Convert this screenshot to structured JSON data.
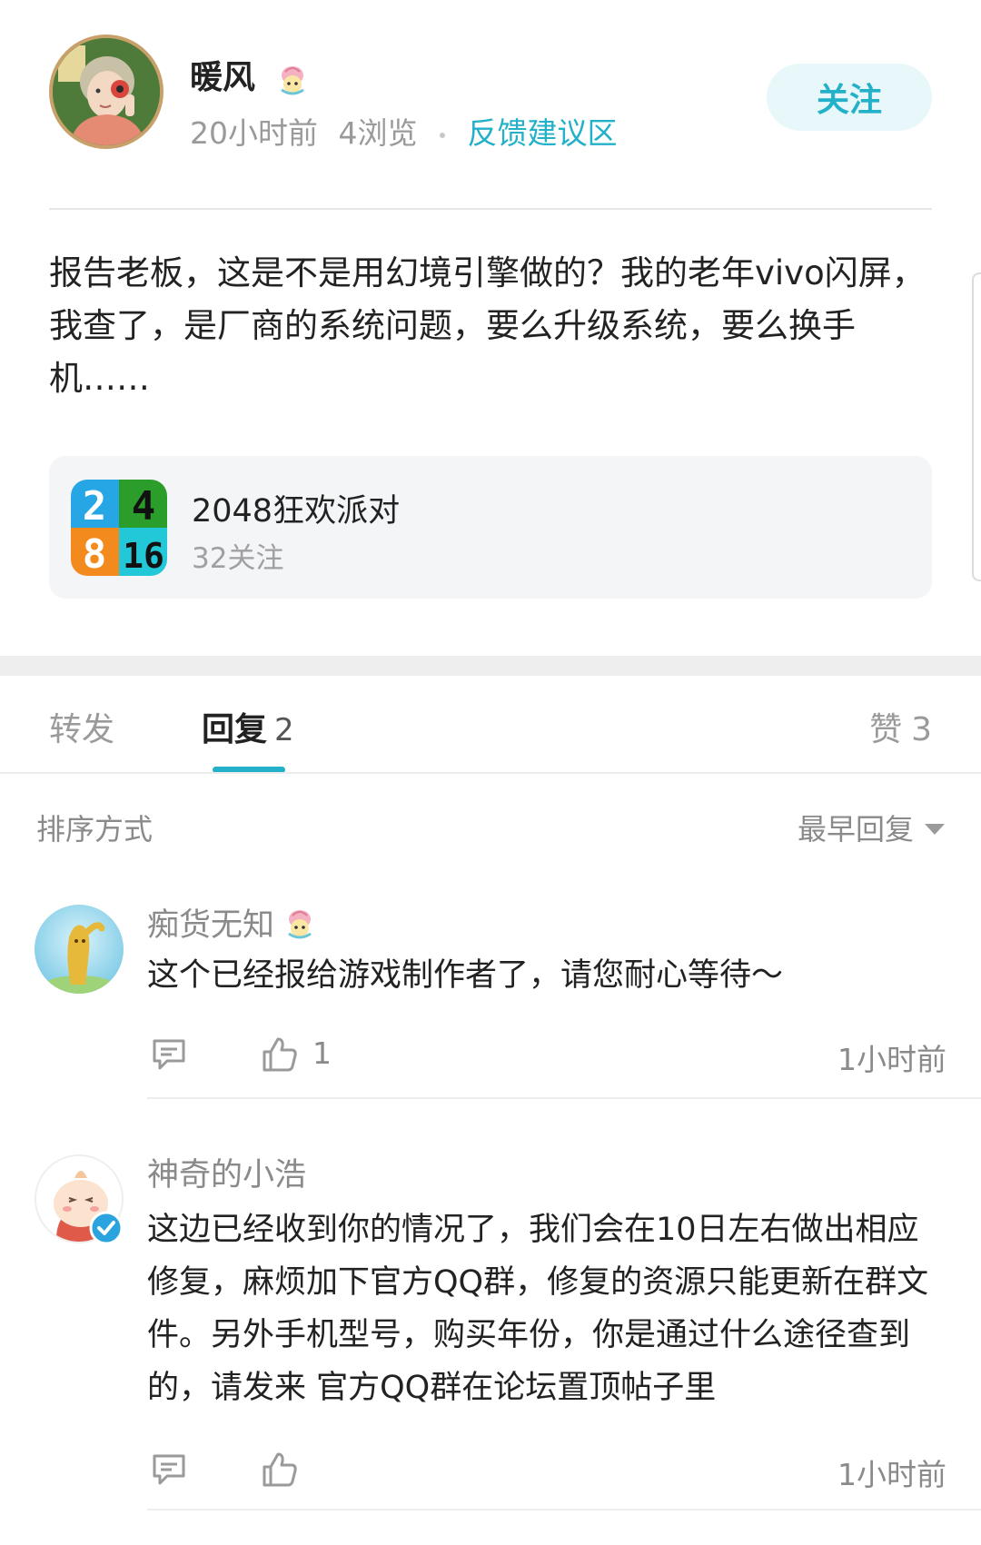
{
  "post": {
    "author_name": "暖风",
    "time": "20小时前",
    "views": "4浏览",
    "section": "反馈建议区",
    "follow_label": "关注",
    "body": "报告老板，这是不是用幻境引擎做的？我的老年vivo闪屏，我查了，是厂商的系统问题，要么升级系统，要么换手机……"
  },
  "game_card": {
    "title": "2048狂欢派对",
    "followers": "32关注",
    "icon_digits": [
      "2",
      "4",
      "8",
      "16"
    ]
  },
  "tabs": {
    "forward_label": "转发",
    "reply_label": "回复",
    "reply_count": "2",
    "like_label": "赞",
    "like_count": "3"
  },
  "sort": {
    "label": "排序方式",
    "selected": "最早回复"
  },
  "comments": [
    {
      "name": "痴货无知",
      "text": "这个已经报给游戏制作者了，请您耐心等待～",
      "like_count": "1",
      "time": "1小时前"
    },
    {
      "name": "神奇的小浩",
      "text": "这边已经收到你的情况了，我们会在10日左右做出相应修复，麻烦加下官方QQ群，修复的资源只能更新在群文件。另外手机型号，购买年份，你是通过什么途径查到的，请发来 官方QQ群在论坛置顶帖子里",
      "like_count": "",
      "time": "1小时前"
    }
  ],
  "colors": {
    "accent": "#23b0c9",
    "follow_bg": "#e8f7f9",
    "secondary_text": "#8a8a8a",
    "card_bg": "#f4f5f7"
  },
  "icons": {
    "reply": "comment-bubble-icon",
    "like": "thumbs-up-icon",
    "dropdown": "caret-down-icon",
    "badge": "level-badge-icon",
    "verified": "verified-check-icon"
  }
}
